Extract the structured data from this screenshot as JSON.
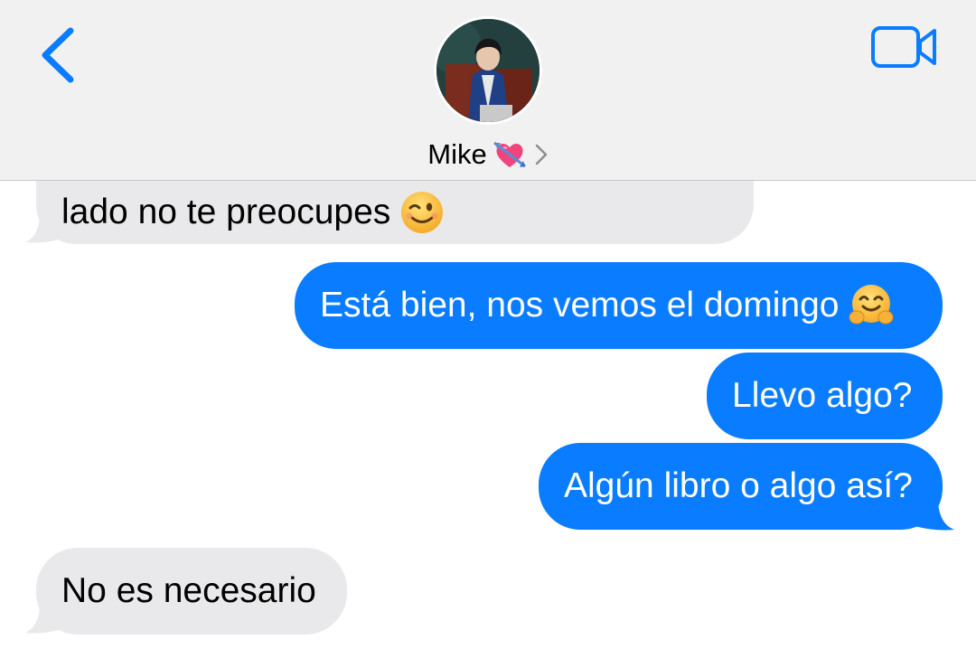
{
  "header": {
    "contact_name": "Mike",
    "contact_emoji_icon": "heart-with-arrow-icon",
    "back_icon": "chevron-left-icon",
    "video_icon": "video-camera-icon",
    "disclosure_icon": "chevron-right-icon"
  },
  "messages": [
    {
      "direction": "received",
      "text": "lado no te preocupes",
      "emoji_icon": "winking-face-icon"
    },
    {
      "direction": "sent",
      "text": "Está bien, nos vemos el domingo",
      "emoji_icon": "hugging-face-icon"
    },
    {
      "direction": "sent",
      "text": "Llevo algo?"
    },
    {
      "direction": "sent",
      "text": "Algún libro o algo así?"
    },
    {
      "direction": "received",
      "text": "No es necesario"
    }
  ],
  "colors": {
    "sent_bubble": "#0a7cff",
    "received_bubble": "#e9e9eb",
    "accent": "#0a7cff",
    "header_bg": "#f1f1f2"
  }
}
